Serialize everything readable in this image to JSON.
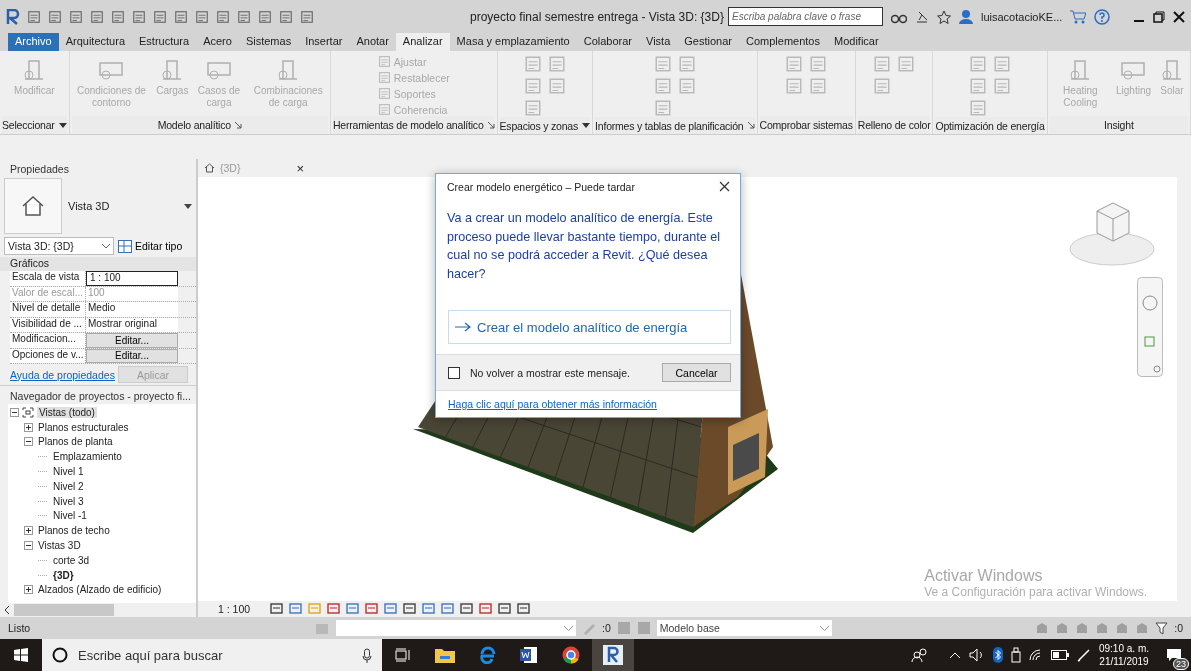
{
  "title_bar": {
    "title": "proyecto final semestre entrega - Vista 3D: {3D}",
    "search": {
      "placeholder": "Escriba palabra clave o frase"
    },
    "user": "luisacotacioKE..."
  },
  "ribbon_tabs": [
    {
      "label": "Archivo",
      "kind": "file",
      "selected": false
    },
    {
      "label": "Arquitectura",
      "kind": "tab",
      "selected": false
    },
    {
      "label": "Estructura",
      "kind": "tab",
      "selected": false
    },
    {
      "label": "Acero",
      "kind": "tab",
      "selected": false
    },
    {
      "label": "Sistemas",
      "kind": "tab",
      "selected": false
    },
    {
      "label": "Insertar",
      "kind": "tab",
      "selected": false
    },
    {
      "label": "Anotar",
      "kind": "tab",
      "selected": false
    },
    {
      "label": "Analizar",
      "kind": "tab",
      "selected": true
    },
    {
      "label": "Masa y emplazamiento",
      "kind": "tab",
      "selected": false
    },
    {
      "label": "Colaborar",
      "kind": "tab",
      "selected": false
    },
    {
      "label": "Vista",
      "kind": "tab",
      "selected": false
    },
    {
      "label": "Gestionar",
      "kind": "tab",
      "selected": false
    },
    {
      "label": "Complementos",
      "kind": "tab",
      "selected": false
    },
    {
      "label": "Modificar",
      "kind": "tab",
      "selected": false
    }
  ],
  "ribbon_panels": [
    {
      "title": "Seleccionar",
      "dropdown": true,
      "launcher": false,
      "buttons": [
        {
          "kind": "large",
          "label": "Modificar"
        }
      ]
    },
    {
      "title": "Modelo analítico",
      "dropdown": false,
      "launcher": true,
      "buttons": [
        {
          "kind": "large",
          "label": "Condiciones de contorno"
        },
        {
          "kind": "large",
          "label": "Cargas"
        },
        {
          "kind": "large",
          "label": "Casos de carga"
        },
        {
          "kind": "large",
          "label": "Combinaciones de carga"
        }
      ]
    },
    {
      "title": "Herramientas de modelo analítico",
      "dropdown": false,
      "launcher": true,
      "buttons": [
        {
          "kind": "small",
          "label": "Ajustar"
        },
        {
          "kind": "small",
          "label": "Restablecer"
        },
        {
          "kind": "small",
          "label": "Soportes"
        },
        {
          "kind": "small",
          "label": "Coherencia"
        }
      ]
    },
    {
      "title": "Espacios y zonas",
      "dropdown": true,
      "launcher": false,
      "buttons": [
        {
          "kind": "icon"
        },
        {
          "kind": "icon"
        },
        {
          "kind": "icon"
        },
        {
          "kind": "icon"
        },
        {
          "kind": "icon"
        }
      ]
    },
    {
      "title": "Informes y tablas de planificación",
      "dropdown": false,
      "launcher": true,
      "buttons": [
        {
          "kind": "icon"
        },
        {
          "kind": "icon"
        },
        {
          "kind": "icon"
        },
        {
          "kind": "icon"
        },
        {
          "kind": "icon"
        }
      ]
    },
    {
      "title": "Comprobar sistemas",
      "dropdown": false,
      "launcher": false,
      "buttons": [
        {
          "kind": "icon"
        },
        {
          "kind": "icon"
        },
        {
          "kind": "icon"
        },
        {
          "kind": "icon"
        }
      ]
    },
    {
      "title": "Relleno de color",
      "dropdown": false,
      "launcher": false,
      "buttons": [
        {
          "kind": "icon"
        },
        {
          "kind": "icon"
        },
        {
          "kind": "icon"
        }
      ]
    },
    {
      "title": "Optimización de energía",
      "dropdown": false,
      "launcher": false,
      "buttons": [
        {
          "kind": "icon"
        },
        {
          "kind": "icon"
        },
        {
          "kind": "icon"
        },
        {
          "kind": "icon"
        },
        {
          "kind": "icon"
        }
      ]
    },
    {
      "title": "Insight",
      "dropdown": false,
      "launcher": false,
      "buttons": [
        {
          "kind": "large",
          "label": "Heating Cooling"
        },
        {
          "kind": "large",
          "label": "Lighting"
        },
        {
          "kind": "large",
          "label": "Solar"
        }
      ]
    }
  ],
  "properties": {
    "title": "Propiedades",
    "type_name": "Vista 3D",
    "view_selector": "Vista 3D: {3D}",
    "edit_type": "Editar tipo",
    "group": "Gráficos",
    "rows": [
      {
        "name": "Escala de vista",
        "value": "1 : 100",
        "kind": "input",
        "disabled": false
      },
      {
        "name": "Valor de escal...",
        "value": "100",
        "kind": "text",
        "disabled": true
      },
      {
        "name": "Nivel de detalle",
        "value": "Medio",
        "kind": "text",
        "disabled": false
      },
      {
        "name": "Visibilidad de ...",
        "value": "Mostrar original",
        "kind": "text",
        "disabled": false
      },
      {
        "name": "Modificacion...",
        "value": "Editar...",
        "kind": "button",
        "disabled": false
      },
      {
        "name": "Opciones de v...",
        "value": "Editar...",
        "kind": "button",
        "disabled": false
      }
    ],
    "help_link": "Ayuda de propiedades",
    "apply": {
      "label": "Aplicar",
      "disabled": true
    }
  },
  "project_browser": {
    "title": "Navegador de proyectos - proyecto fi...",
    "tree": [
      {
        "label": "Vistas (todo)",
        "expanded": true,
        "selected": true,
        "active": false,
        "children": [
          {
            "label": "Planos estructurales",
            "expanded": false,
            "selected": false,
            "active": false
          },
          {
            "label": "Planos de planta",
            "expanded": true,
            "selected": false,
            "active": false,
            "children": [
              {
                "label": "Emplazamiento",
                "selected": false,
                "active": false
              },
              {
                "label": "Nivel 1",
                "selected": false,
                "active": false
              },
              {
                "label": "Nivel 2",
                "selected": false,
                "active": false
              },
              {
                "label": "Nivel 3",
                "selected": false,
                "active": false
              },
              {
                "label": "Nivel -1",
                "selected": false,
                "active": false
              }
            ]
          },
          {
            "label": "Planos de techo",
            "expanded": false,
            "selected": false,
            "active": false
          },
          {
            "label": "Vistas 3D",
            "expanded": true,
            "selected": false,
            "active": false,
            "children": [
              {
                "label": "corte 3d",
                "selected": false,
                "active": false
              },
              {
                "label": "{3D}",
                "selected": false,
                "active": true
              }
            ]
          },
          {
            "label": "Alzados (Alzado de edificio)",
            "expanded": false,
            "selected": false,
            "active": false
          }
        ]
      }
    ]
  },
  "view_tab": {
    "label": "{3D}",
    "close": "×"
  },
  "dialog": {
    "title": "Crear modelo energético – Puede tardar",
    "message": "Va a crear un modelo analítico de energía. Este proceso puede llevar bastante tiempo, durante el cual no se podrá acceder a Revit. ¿Qué desea hacer?",
    "command": "Crear el modelo analítico de energía",
    "checkbox": {
      "label": "No volver a mostrar este mensaje.",
      "checked": false
    },
    "cancel": "Cancelar",
    "link": "Haga clic aquí para obtener más información"
  },
  "activation_notice": {
    "title": "Activar Windows",
    "subtitle": "Ve a Configuración para activar Windows."
  },
  "view_control_bar": {
    "scale": "1 : 100"
  },
  "status_bar": {
    "message": "Listo",
    "selection_count": ":0",
    "workset": "Modelo base",
    "filter_count": ":0"
  },
  "taskbar": {
    "search_placeholder": "Escribe aquí para buscar",
    "time": "09:10 a. m.",
    "date": "21/11/2019",
    "notifications": "23"
  }
}
